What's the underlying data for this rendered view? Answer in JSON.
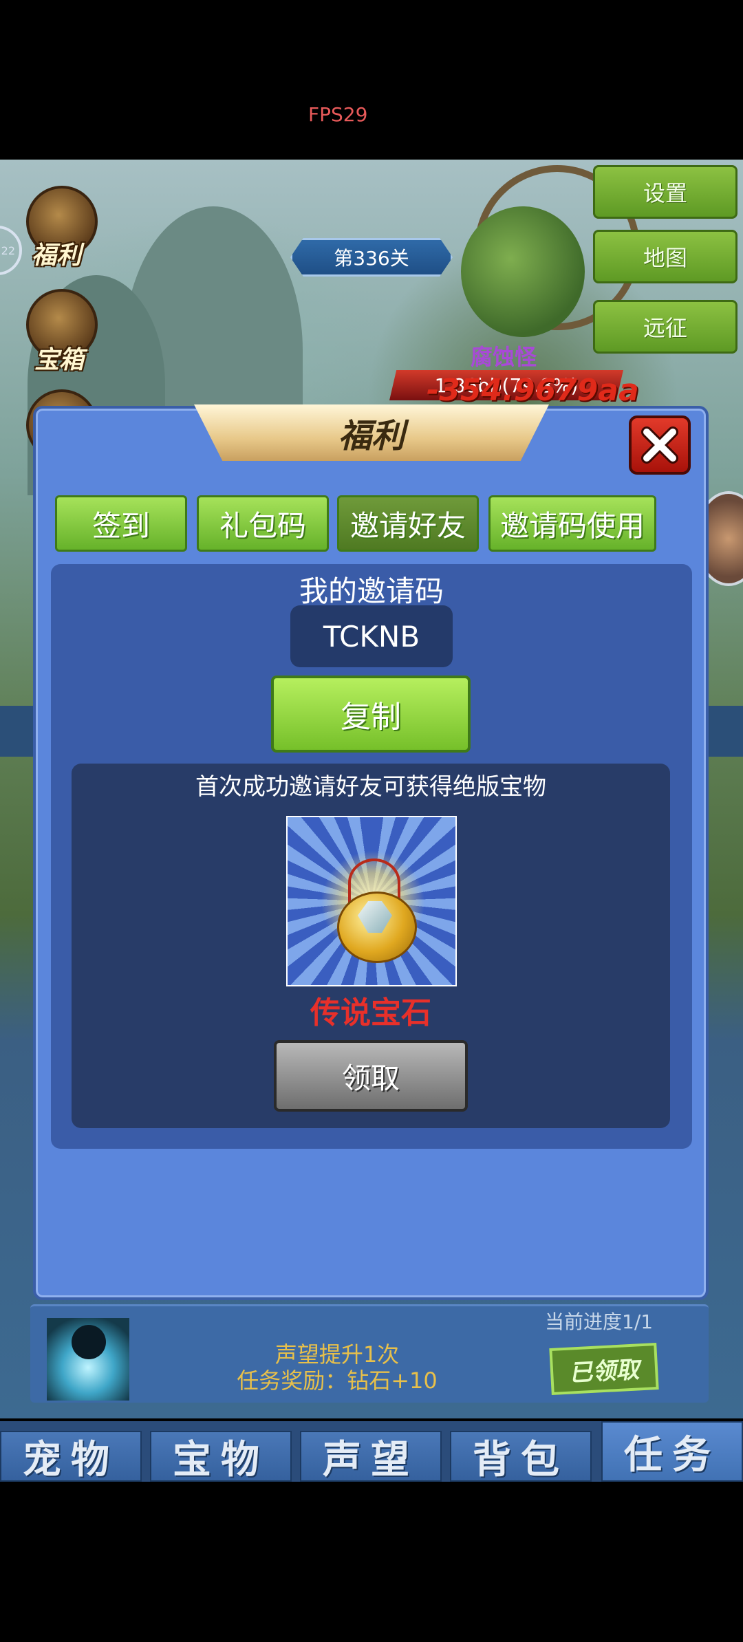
{
  "status": {
    "fps": "FPS29"
  },
  "scene": {
    "level": "第336关",
    "left_icons": [
      {
        "label": "福利"
      },
      {
        "label": "宝箱"
      }
    ],
    "edge_badge": "22",
    "side_buttons": [
      {
        "label": "设置"
      },
      {
        "label": "地图"
      },
      {
        "label": "远征"
      }
    ],
    "enemy_name": "腐蚀怪",
    "enemy_hp": "1.86bb(79.8%)",
    "damage_text": "-354.9679aa"
  },
  "modal": {
    "title": "福利",
    "tabs": [
      {
        "label": "签到"
      },
      {
        "label": "礼包码"
      },
      {
        "label": "邀请好友",
        "active": true
      },
      {
        "label": "邀请码使用"
      }
    ],
    "invite_code_label": "我的邀请码",
    "invite_code": "TCKNB",
    "copy_label": "复制",
    "reward_desc": "首次成功邀请好友可获得绝版宝物",
    "reward_item_name": "传说宝石",
    "claim_label": "领取"
  },
  "quest": {
    "progress": "当前进度1/1",
    "line1": "声望提升1次",
    "line2": "任务奖励：钻石+10",
    "claim_label": "已领取"
  },
  "bottom_tabs": [
    {
      "label": "宠物"
    },
    {
      "label": "宝物"
    },
    {
      "label": "声望"
    },
    {
      "label": "背包"
    },
    {
      "label": "任务",
      "active": true
    }
  ],
  "colors": {
    "modal_bg": "#5b86dc",
    "tab_green": "#76c02a",
    "reward_name_red": "#e8302a",
    "quest_text": "#e8c04a"
  }
}
